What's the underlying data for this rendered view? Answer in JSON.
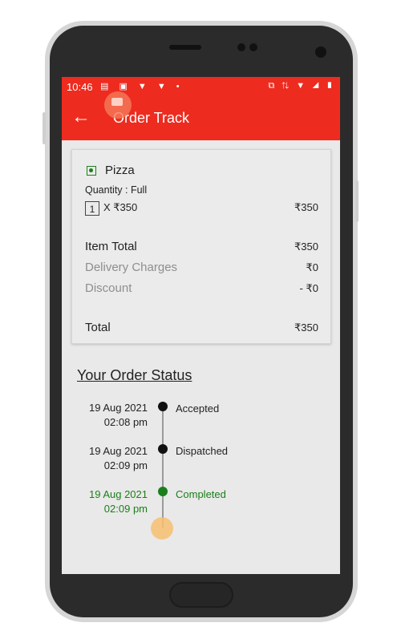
{
  "status_bar": {
    "time": "10:46",
    "left_icons": "▤ ▣ ▼ ▼ •",
    "right_icons": "⧉ ⇅ ▼ ◢ ▮"
  },
  "app_bar": {
    "title": "Order Track",
    "back_icon": "←"
  },
  "order": {
    "item_name": "Pizza",
    "quantity_label": "Quantity : Full",
    "qty": "1",
    "qty_price": "X ₹350",
    "line_total": "₹350",
    "item_total_label": "Item Total",
    "item_total": "₹350",
    "delivery_label": "Delivery Charges",
    "delivery": "₹0",
    "discount_label": "Discount",
    "discount": "- ₹0",
    "total_label": "Total",
    "total": "₹350"
  },
  "status": {
    "title": "Your Order Status",
    "steps": [
      {
        "date": "19 Aug 2021",
        "time": "02:08 pm",
        "label": "Accepted",
        "color": "#111111"
      },
      {
        "date": "19 Aug 2021",
        "time": "02:09 pm",
        "label": "Dispatched",
        "color": "#111111"
      },
      {
        "date": "19 Aug 2021",
        "time": "02:09 pm",
        "label": "Completed",
        "color": "#1a7f1a"
      }
    ]
  },
  "colors": {
    "primary": "#ee2b1f",
    "veg": "#1a7f1a",
    "completed": "#1a7f1a",
    "muted": "#8e8e8e"
  }
}
